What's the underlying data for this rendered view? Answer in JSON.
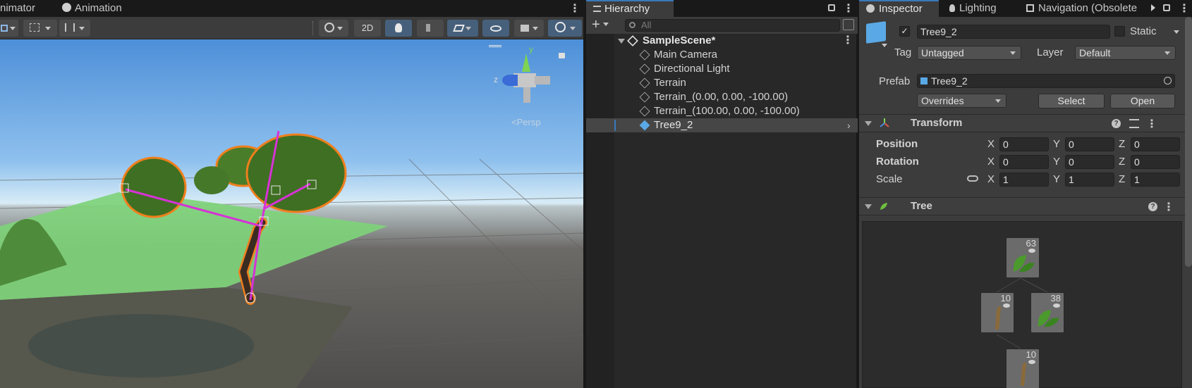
{
  "scene": {
    "tabs": [
      {
        "label": "nimator"
      },
      {
        "label": "Animation"
      }
    ],
    "toolbar": {
      "mode_2d": "2D"
    },
    "gizmo": {
      "y_label": "y",
      "z_label": "z",
      "persp_label": "<Persp"
    }
  },
  "hierarchy": {
    "tab_label": "Hierarchy",
    "search_placeholder": "All",
    "scene_name": "SampleScene*",
    "items": [
      {
        "label": "Main Camera"
      },
      {
        "label": "Directional Light"
      },
      {
        "label": "Terrain"
      },
      {
        "label": "Terrain_(0.00, 0.00, -100.00)"
      },
      {
        "label": "Terrain_(100.00, 0.00, -100.00)"
      },
      {
        "label": "Tree9_2"
      }
    ]
  },
  "inspector": {
    "tabs": [
      {
        "label": "Inspector"
      },
      {
        "label": "Lighting"
      },
      {
        "label": "Navigation (Obsolete"
      }
    ],
    "object_name": "Tree9_2",
    "static_label": "Static",
    "tag_label": "Tag",
    "tag_value": "Untagged",
    "layer_label": "Layer",
    "layer_value": "Default",
    "prefab_label": "Prefab",
    "prefab_value": "Tree9_2",
    "overrides_label": "Overrides",
    "select_label": "Select",
    "open_label": "Open",
    "transform": {
      "title": "Transform",
      "position_label": "Position",
      "rotation_label": "Rotation",
      "scale_label": "Scale",
      "position": {
        "x": "0",
        "y": "0",
        "z": "0"
      },
      "rotation": {
        "x": "0",
        "y": "0",
        "z": "0"
      },
      "scale": {
        "x": "1",
        "y": "1",
        "z": "1"
      }
    },
    "tree": {
      "title": "Tree",
      "nodes": [
        {
          "count": "63",
          "kind": "leaf"
        },
        {
          "count": "10",
          "kind": "branch"
        },
        {
          "count": "38",
          "kind": "leaf"
        },
        {
          "count": "10",
          "kind": "branch"
        }
      ]
    },
    "axis_labels": {
      "x": "X",
      "y": "Y",
      "z": "Z"
    }
  },
  "colors": {
    "accent_blue": "#3a79bb",
    "selection_orange": "#f07f1d",
    "bone_magenta": "#d632d6"
  }
}
